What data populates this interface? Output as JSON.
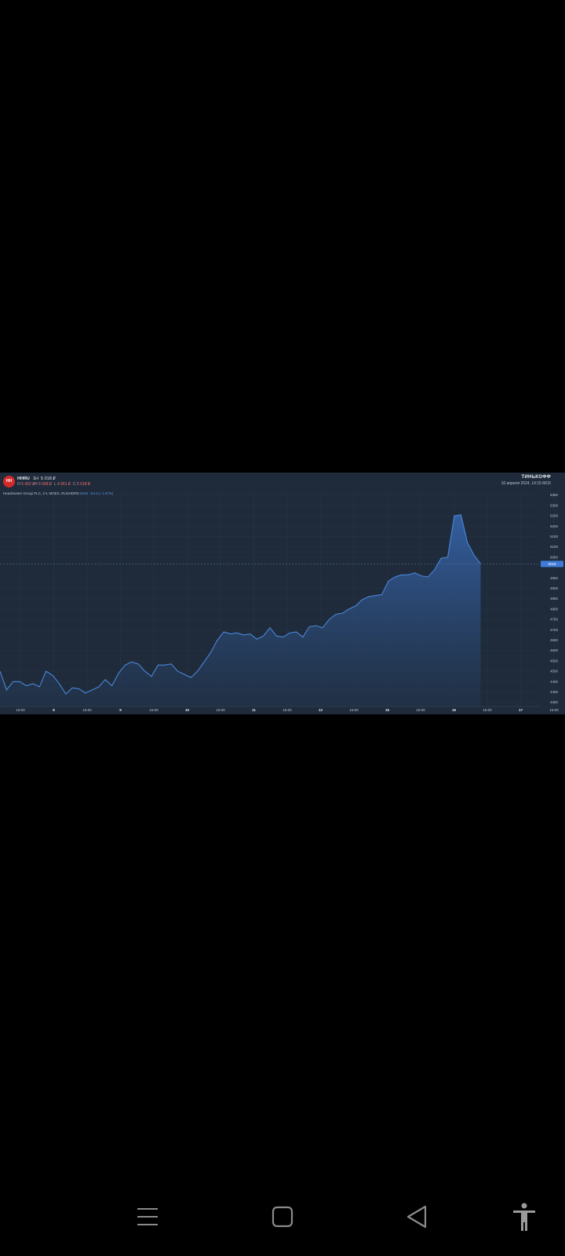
{
  "header": {
    "badge": "HH",
    "ticker": "HHRU",
    "timeframe": "1Н",
    "last": "5 018 ₽",
    "ohlc": [
      {
        "k": "O",
        "v": "5 062 ₽"
      },
      {
        "k": "H",
        "v": "5 068 ₽"
      },
      {
        "k": "L",
        "v": "4 961 ₽"
      },
      {
        "k": "C",
        "v": "5 018 ₽"
      }
    ],
    "subtitle": "HeadHunter Group PLC, 1Ч, MOEX, RUSHDRD",
    "indicator": "5018 −84.6 (−1.67%)",
    "brand": "ТИНЬКОФФ",
    "datestamp": "16 апреля 2024, 14:15 МСК"
  },
  "price_tag": "5018",
  "colors": {
    "background": "#1f2b3a",
    "line": "#4a86d8",
    "area_top": "#3a6fc0",
    "area_bottom": "#22344d",
    "grid": "#2c3a4c"
  },
  "chart_data": {
    "type": "area",
    "x_ticks": [
      "15:00",
      "8",
      "15:00",
      "9",
      "15:00",
      "10",
      "15:00",
      "11",
      "15:00",
      "12",
      "15:00",
      "15",
      "15:00",
      "16",
      "15:00",
      "17",
      "15:00"
    ],
    "major_ticks": [
      "8",
      "9",
      "10",
      "11",
      "12",
      "15",
      "16",
      "17"
    ],
    "y_ticks": [
      "5350",
      "5300",
      "5250",
      "5200",
      "5150",
      "5100",
      "5050",
      "4950",
      "4900",
      "4850",
      "4800",
      "4750",
      "4700",
      "4650",
      "4600",
      "4550",
      "4500",
      "4450",
      "4400",
      "4350"
    ],
    "ylim": [
      4330,
      5360
    ],
    "x_range": [
      0,
      82
    ],
    "values": [
      4500,
      4410,
      4450,
      4450,
      4430,
      4440,
      4425,
      4500,
      4480,
      4440,
      4390,
      4420,
      4415,
      4395,
      4410,
      4425,
      4460,
      4430,
      4490,
      4530,
      4545,
      4535,
      4500,
      4475,
      4530,
      4530,
      4535,
      4500,
      4485,
      4470,
      4500,
      4545,
      4590,
      4650,
      4690,
      4680,
      4685,
      4675,
      4680,
      4655,
      4670,
      4710,
      4670,
      4665,
      4685,
      4690,
      4665,
      4715,
      4720,
      4710,
      4750,
      4775,
      4780,
      4800,
      4815,
      4845,
      4860,
      4865,
      4870,
      4935,
      4955,
      4965,
      4965,
      4975,
      4960,
      4955,
      4990,
      5045,
      5050,
      5250,
      5255,
      5120,
      5060,
      5018
    ]
  }
}
